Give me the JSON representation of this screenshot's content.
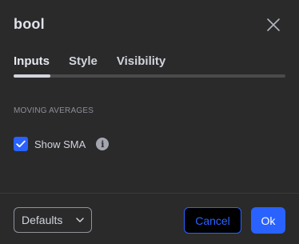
{
  "dialog": {
    "title": "bool"
  },
  "tabs": [
    {
      "label": "Inputs",
      "active": true
    },
    {
      "label": "Style",
      "active": false
    },
    {
      "label": "Visibility",
      "active": false
    }
  ],
  "section": {
    "title": "MOVING AVERAGES",
    "option": {
      "label": "Show SMA",
      "checked": true
    }
  },
  "footer": {
    "defaults_label": "Defaults",
    "cancel_label": "Cancel",
    "ok_label": "Ok"
  },
  "icons": {
    "close": "close-icon",
    "check": "check-icon",
    "info": "info-icon",
    "chevron": "chevron-down-icon"
  },
  "colors": {
    "background": "#2a2a2b",
    "accent": "#2962ff",
    "text": "#d1d4dc",
    "muted": "#8d8f96"
  }
}
